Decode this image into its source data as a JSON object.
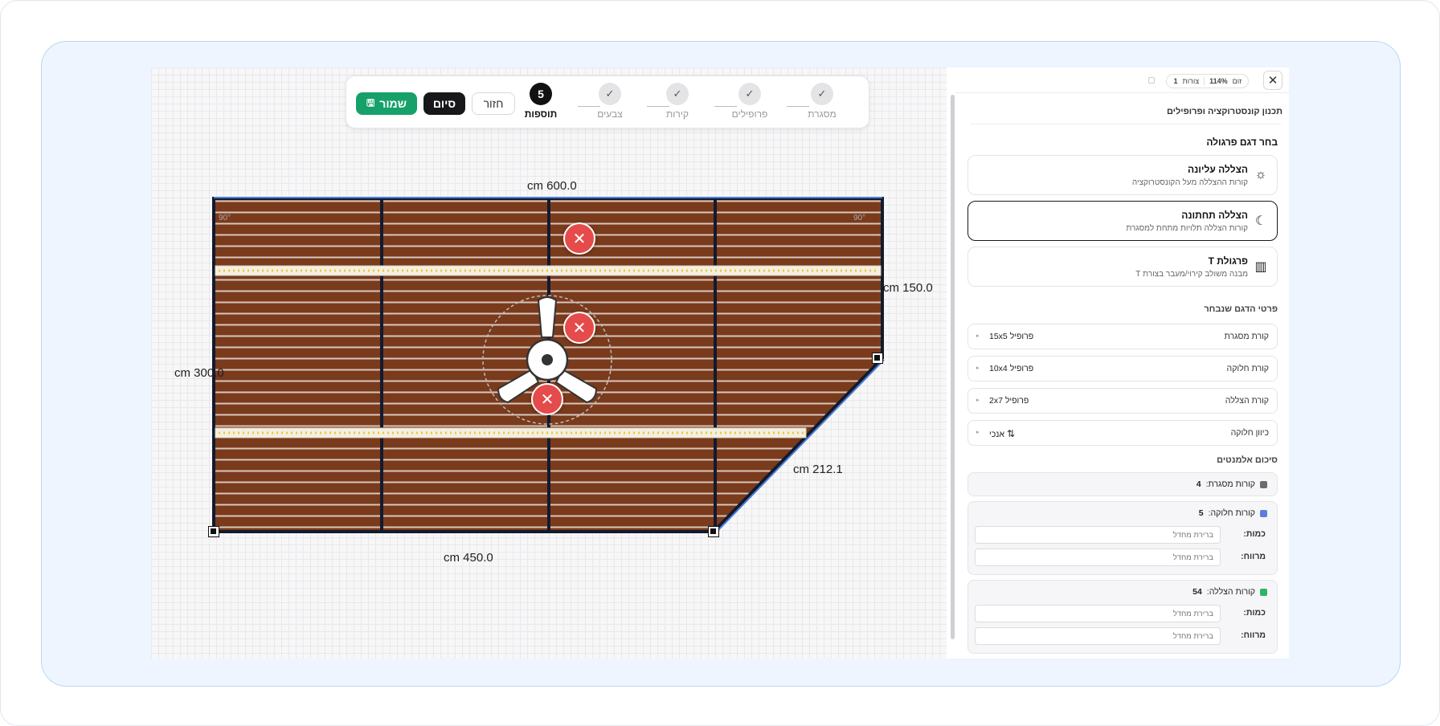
{
  "stepper": {
    "steps": [
      {
        "label": "מסגרת",
        "state": "done"
      },
      {
        "label": "פרופילים",
        "state": "done"
      },
      {
        "label": "קירות",
        "state": "done"
      },
      {
        "label": "צבעים",
        "state": "done"
      },
      {
        "label": "תוספות",
        "state": "active",
        "number": "5"
      }
    ],
    "save_label": "שמור",
    "finish_label": "סיום",
    "back_label": "חזור"
  },
  "canvas": {
    "dims": {
      "top": "cm 600.0",
      "right": "cm 150.0",
      "left": "cm 300.0",
      "diagonal": "cm 212.1",
      "bottom": "cm 450.0"
    }
  },
  "panel": {
    "zoom_label": "זום",
    "zoom_value": "114%",
    "count_label": "צורות",
    "count_value": "1",
    "title": "תכנון קונסטרוקציה ופרופילים",
    "model_section": "בחר דגם פרגולה",
    "models": [
      {
        "title": "הצללה עליונה",
        "desc": "קורות ההצללה מעל הקונסטרוקציה",
        "icon": "sun-icon"
      },
      {
        "title": "הצללה תחתונה",
        "desc": "קורות הצללה תלויות מתחת למסגרת",
        "icon": "moon-icon"
      },
      {
        "title": "פרגולת T",
        "desc": "מבנה משולב קירוי/מעבר בצורת T",
        "icon": "columns-icon"
      }
    ],
    "selected_model": "הצללה תחתונה",
    "details_section": "פרטי הדגם שנבחר",
    "details": [
      {
        "label": "קורת מסגרת",
        "value": "פרופיל 15x5"
      },
      {
        "label": "קורת חלוקה",
        "value": "פרופיל 10x4"
      },
      {
        "label": "קורת הצללה",
        "value": "פרופיל 2x7"
      },
      {
        "label": "כיוון חלוקה",
        "value": "אנכי"
      }
    ],
    "summary_section": "סיכום אלמנטים",
    "summary": {
      "frame": {
        "label": "קורות מסגרת:",
        "count": "4",
        "color": "#6b6b6b"
      },
      "division": {
        "label": "קורות חלוקה:",
        "count": "5",
        "color": "#5b7fd6"
      },
      "shading": {
        "label": "קורות הצללה:",
        "count": "54",
        "color": "#2fb26a"
      },
      "qty_label": "כמות:",
      "spacing_label": "מרווח:",
      "default_placeholder": "ברירת מחדל"
    }
  }
}
